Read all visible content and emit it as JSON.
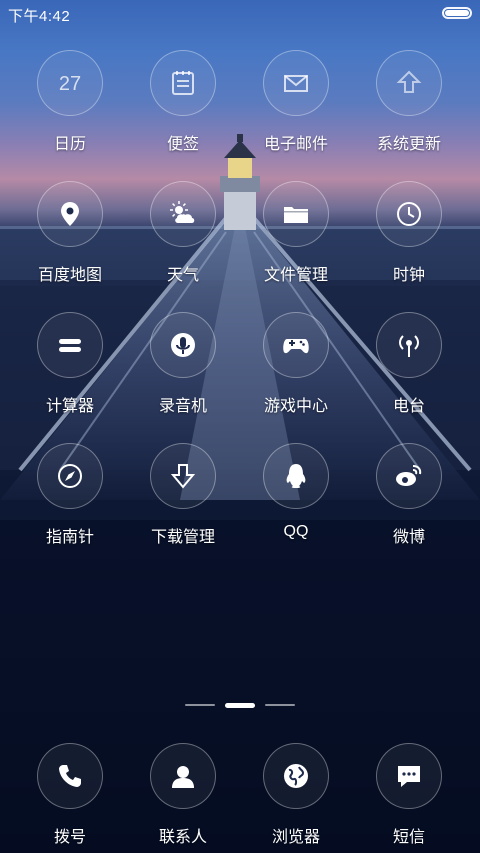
{
  "status": {
    "time": "下午4:42",
    "battery_level": 1.0
  },
  "apps": [
    {
      "label": "日历",
      "icon": "calendar-icon",
      "text": "27"
    },
    {
      "label": "便签",
      "icon": "notes-icon"
    },
    {
      "label": "电子邮件",
      "icon": "email-icon"
    },
    {
      "label": "系统更新",
      "icon": "system-update-icon"
    },
    {
      "label": "百度地图",
      "icon": "map-pin-icon"
    },
    {
      "label": "天气",
      "icon": "weather-icon"
    },
    {
      "label": "文件管理",
      "icon": "folder-icon"
    },
    {
      "label": "时钟",
      "icon": "clock-icon"
    },
    {
      "label": "计算器",
      "icon": "calculator-icon"
    },
    {
      "label": "录音机",
      "icon": "recorder-icon"
    },
    {
      "label": "游戏中心",
      "icon": "gamepad-icon"
    },
    {
      "label": "电台",
      "icon": "radio-icon"
    },
    {
      "label": "指南针",
      "icon": "compass-icon"
    },
    {
      "label": "下载管理",
      "icon": "download-icon"
    },
    {
      "label": "QQ",
      "icon": "qq-icon"
    },
    {
      "label": "微博",
      "icon": "weibo-icon"
    }
  ],
  "pager": {
    "pages": 3,
    "current": 2
  },
  "dock": [
    {
      "label": "拨号",
      "icon": "phone-icon"
    },
    {
      "label": "联系人",
      "icon": "contacts-icon"
    },
    {
      "label": "浏览器",
      "icon": "browser-icon"
    },
    {
      "label": "短信",
      "icon": "sms-icon"
    }
  ]
}
